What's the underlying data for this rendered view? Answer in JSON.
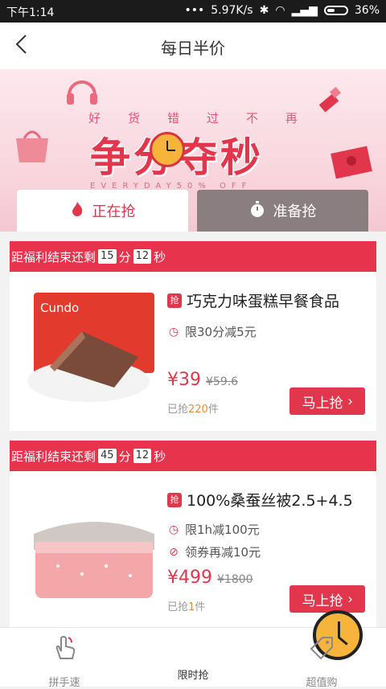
{
  "status": {
    "time": "下午1:14",
    "speed": "5.97K/s",
    "battery": "36%"
  },
  "header": {
    "title": "每日半价"
  },
  "banner": {
    "slogan_chars": [
      "好",
      "货",
      "错",
      "过",
      "不",
      "再"
    ],
    "big_title": "争分夺秒",
    "subtitle": "EVERYDAY50% OFF"
  },
  "tabs": [
    {
      "label": "正在抢",
      "active": true
    },
    {
      "label": "准备抢",
      "active": false
    }
  ],
  "sections": [
    {
      "countdown_prefix": "距福利结束还剩",
      "minutes": "15",
      "min_unit": "分",
      "seconds": "12",
      "sec_unit": "秒",
      "product": {
        "name": "巧克力味蛋糕早餐食品",
        "lines": [
          {
            "icon": "clock-icon",
            "text": "限30分减5元"
          }
        ],
        "price": "¥39",
        "orig_price": "¥59.6",
        "sold_prefix": "已抢",
        "sold_count": "220",
        "sold_unit": "件",
        "buy_label": "马上抢"
      }
    },
    {
      "countdown_prefix": "距福利结束还剩",
      "minutes": "45",
      "min_unit": "分",
      "seconds": "12",
      "sec_unit": "秒",
      "product": {
        "name": "100%桑蚕丝被2.5+4.5",
        "lines": [
          {
            "icon": "clock-icon",
            "text": "限1h减100元"
          },
          {
            "icon": "coupon-icon",
            "text": "领券再减10元"
          }
        ],
        "price": "¥499",
        "orig_price": "¥1800",
        "sold_prefix": "已抢",
        "sold_count": "1",
        "sold_unit": "件",
        "buy_label": "马上抢"
      }
    }
  ],
  "bottom_nav": [
    {
      "label": "拼手速",
      "icon": "hand-icon"
    },
    {
      "label": "限时抢",
      "icon": "clock-icon"
    },
    {
      "label": "超值购",
      "icon": "tag-icon"
    }
  ],
  "colors": {
    "accent": "#e2364d",
    "orange": "#f08a3a",
    "clock": "#f6b43a"
  }
}
